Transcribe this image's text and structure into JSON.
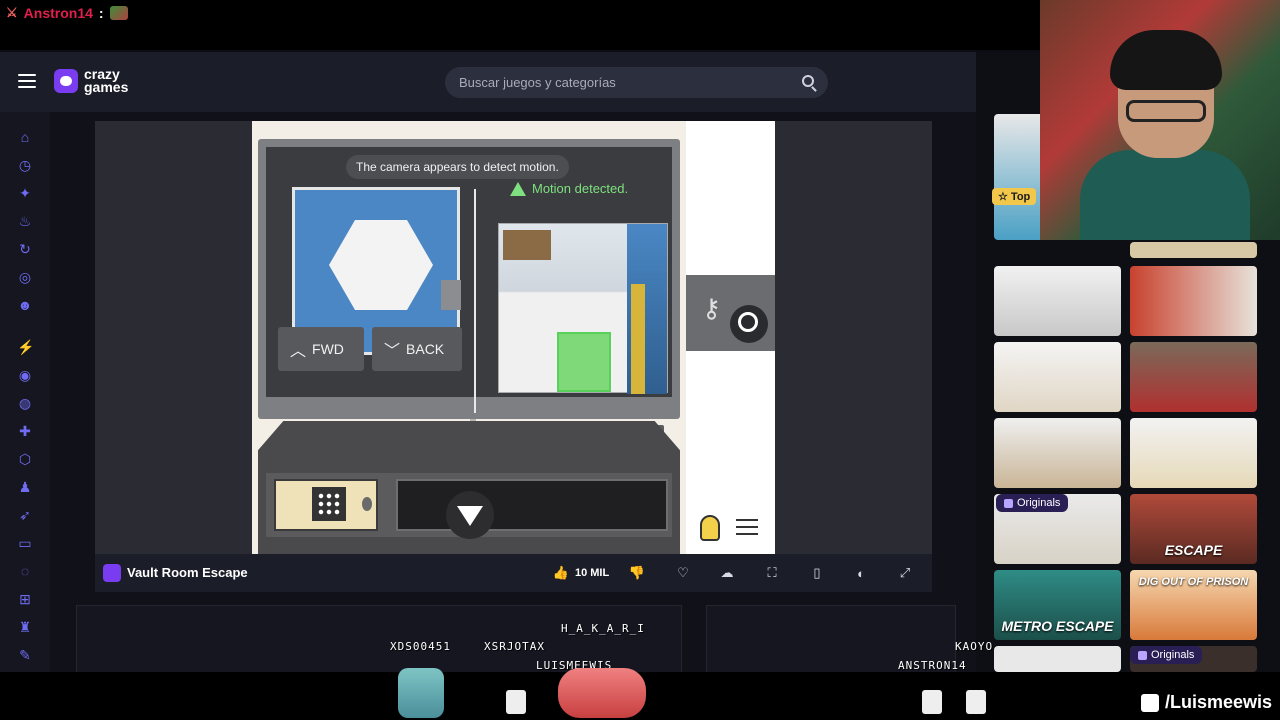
{
  "chat": {
    "user": "Anstron14",
    "separator": ":"
  },
  "header": {
    "logo_line1": "crazy",
    "logo_line2": "games",
    "search_placeholder": "Buscar juegos y categorías"
  },
  "game": {
    "hint_text": "The camera appears to detect motion.",
    "motion_text": "Motion detected.",
    "fwd_label": "FWD",
    "back_label": "BACK",
    "title": "Vault Room Escape"
  },
  "bar": {
    "likes": "10 MIL"
  },
  "thumbs": {
    "top_label": "Top",
    "originals_label": "Originals",
    "escape_label": "ESCAPE",
    "dig_out_label": "DIG OUT OF PRISON",
    "metro_label": "METRO ESCAPE"
  },
  "overlay": {
    "viewers": [
      "XDS00451",
      "XSRJOTAX",
      "H_A_K_A_R_I",
      "LUISMEEWIS",
      "KAOYO",
      "ANSTRON14"
    ],
    "brand": "/Luismeewis"
  },
  "colors": {
    "accent": "#7a3cf0",
    "motion_green": "#7ee07e",
    "chat_user": "#e0204a"
  }
}
